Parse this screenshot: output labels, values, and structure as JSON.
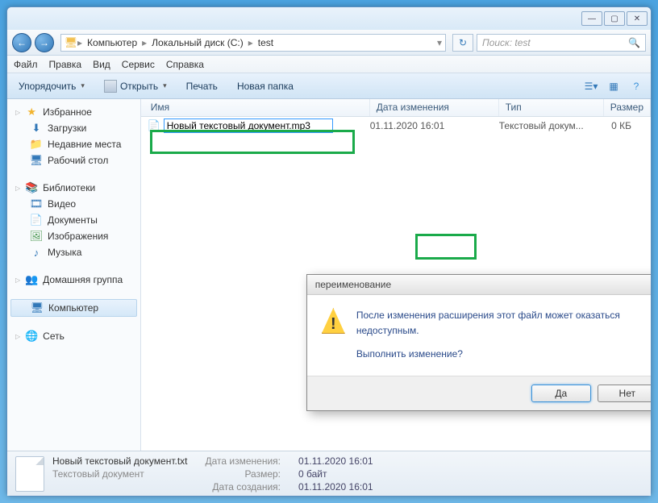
{
  "titlebar": {
    "min": "—",
    "max": "▢",
    "close": "✕"
  },
  "breadcrumb": {
    "computer": "Компьютер",
    "disk": "Локальный диск (C:)",
    "folder": "test"
  },
  "search": {
    "placeholder": "Поиск: test"
  },
  "menu": {
    "file": "Файл",
    "edit": "Правка",
    "view": "Вид",
    "tools": "Сервис",
    "help": "Справка"
  },
  "toolbar": {
    "organize": "Упорядочить",
    "open": "Открыть",
    "print": "Печать",
    "newfolder": "Новая папка"
  },
  "sidebar": {
    "favorites": "Избранное",
    "downloads": "Загрузки",
    "recent": "Недавние места",
    "desktop": "Рабочий стол",
    "libraries": "Библиотеки",
    "video": "Видео",
    "documents": "Документы",
    "pictures": "Изображения",
    "music": "Музыка",
    "homegroup": "Домашняя группа",
    "computer": "Компьютер",
    "network": "Сеть"
  },
  "columns": {
    "name": "Имя",
    "date": "Дата изменения",
    "type": "Тип",
    "size": "Размер"
  },
  "file": {
    "editing_name": "Новый текстовый документ.mp3",
    "date": "01.11.2020 16:01",
    "type": "Текстовый докум...",
    "size": "0 КБ"
  },
  "dialog": {
    "title": "переименование",
    "line1": "После изменения расширения этот файл может оказаться недоступным.",
    "line2": "Выполнить изменение?",
    "yes": "Да",
    "no": "Нет"
  },
  "details": {
    "filename": "Новый текстовый документ.txt",
    "filetype": "Текстовый документ",
    "mod_label": "Дата изменения:",
    "mod_val": "01.11.2020 16:01",
    "size_label": "Размер:",
    "size_val": "0 байт",
    "created_label": "Дата создания:",
    "created_val": "01.11.2020 16:01"
  }
}
